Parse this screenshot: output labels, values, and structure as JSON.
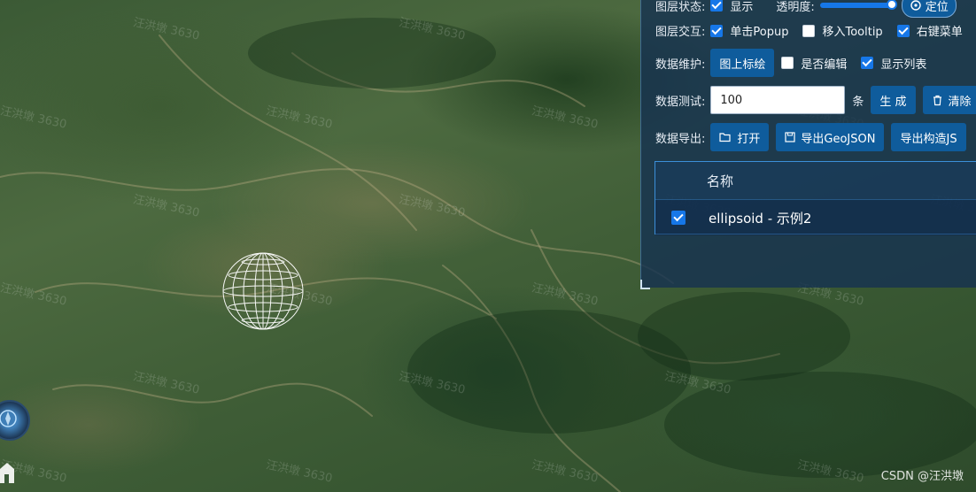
{
  "watermark_text": "汪洪墩 3630",
  "panel": {
    "layer_state": {
      "label": "图层状态:",
      "show_checkbox": {
        "label": "显示",
        "checked": true
      },
      "opacity_label": "透明度:",
      "opacity_value": 1,
      "locate_label": "定位"
    },
    "interaction": {
      "label": "图层交互:",
      "options": [
        {
          "label": "单击Popup",
          "checked": true
        },
        {
          "label": "移入Tooltip",
          "checked": false
        },
        {
          "label": "右键菜单",
          "checked": true
        }
      ]
    },
    "maintenance": {
      "label": "数据维护:",
      "button": "图上标绘",
      "options": [
        {
          "label": "是否编辑",
          "checked": false
        },
        {
          "label": "显示列表",
          "checked": true
        }
      ]
    },
    "test": {
      "label": "数据测试:",
      "input_value": "100",
      "unit": "条",
      "generate_button": "生 成",
      "clear_button": "清除"
    },
    "export": {
      "label": "数据导出:",
      "open_button": "打开",
      "geojson_button": "导出GeoJSON",
      "construct_button": "导出构造JS"
    },
    "table": {
      "column_header": "名称",
      "rows": [
        {
          "name": "ellipsoid - 示例2",
          "checked": true
        }
      ]
    }
  },
  "footer": "CSDN @汪洪墩",
  "icons": [
    "compass-icon",
    "home-icon",
    "folder-open-icon",
    "save-icon",
    "trash-icon",
    "locate-icon",
    "ellipsoid-wireframe-icon"
  ]
}
